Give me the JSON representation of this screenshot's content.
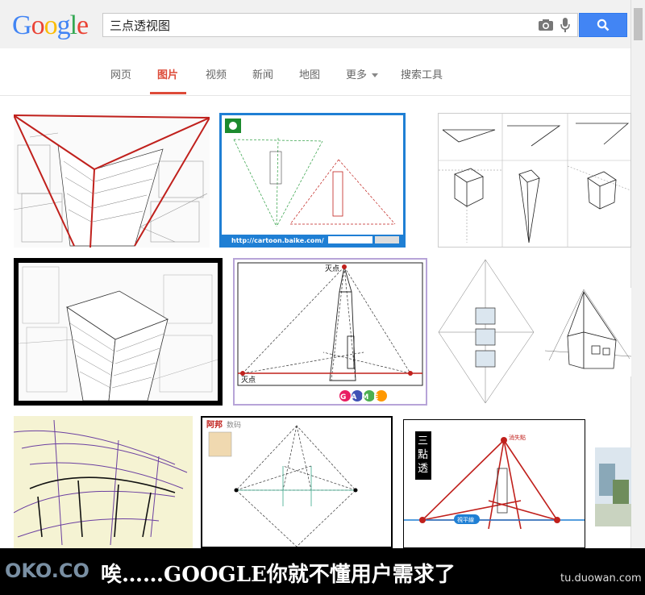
{
  "logo": "Google",
  "search": {
    "query": "三点透视图",
    "camera_icon": "camera-icon",
    "mic_icon": "mic-icon",
    "button_icon": "search-icon"
  },
  "nav": {
    "tabs": [
      {
        "label": "网页",
        "active": false
      },
      {
        "label": "图片",
        "active": true
      },
      {
        "label": "视频",
        "active": false
      },
      {
        "label": "新闻",
        "active": false
      },
      {
        "label": "地图",
        "active": false
      },
      {
        "label": "更多",
        "active": false
      },
      {
        "label": "搜索工具",
        "active": false
      }
    ]
  },
  "results": {
    "url_text": "http://cartoon.baike.com/",
    "label_vanishing": "灭点",
    "label_ahang": "阿邦",
    "label_shuma": "数码",
    "label_sandian_toushi": "三點透視",
    "label_xiaoshi": "消失點",
    "label_pingxian": "視平線",
    "label_game": "GAME",
    "label_sandian_partial": "三点透视"
  },
  "caption": "唉……GOOGLE你就不懂用户需求了",
  "watermark_left": "OKO.CO",
  "watermark_right": "tu.duowan.com",
  "colors": {
    "accent_red": "#dd4b39",
    "blue_button": "#4285f4",
    "perspective_red": "#c0201c"
  }
}
